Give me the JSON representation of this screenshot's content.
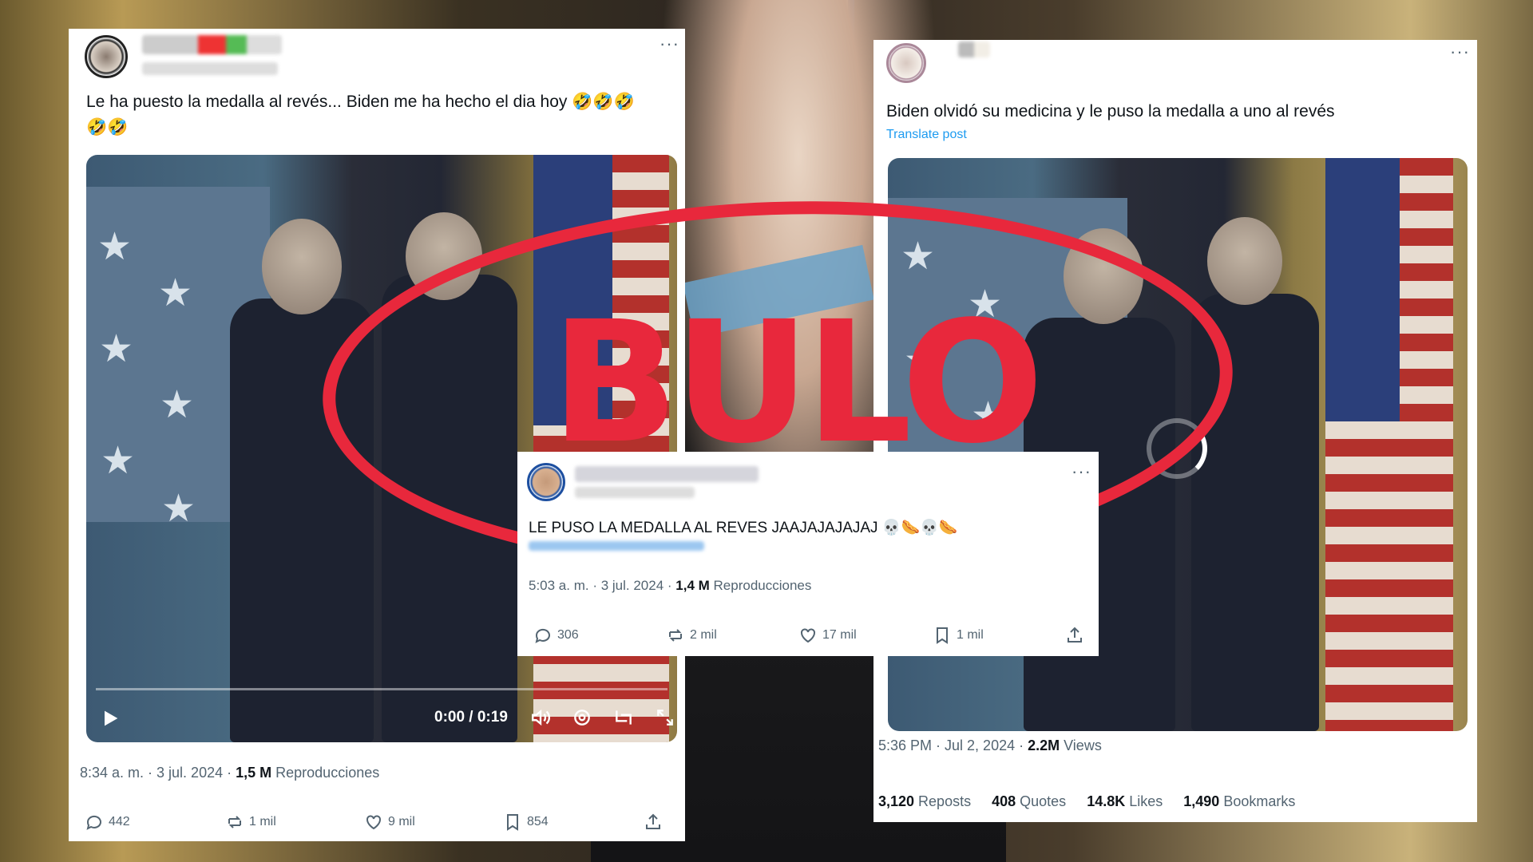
{
  "stamp": {
    "label": "BULO"
  },
  "post_left": {
    "text_line1": "Le ha puesto la medalla al revés... Biden me ha hecho el dia hoy 🤣🤣🤣",
    "text_line2": "🤣🤣",
    "video_time": "0:00 / 0:19",
    "meta": {
      "time": "8:34 a. m. · 3 jul. 2024 · ",
      "views_count": "1,5 M",
      "views_label": " Reproducciones"
    },
    "actions": {
      "replies": "442",
      "reposts": "1 mil",
      "likes": "9 mil",
      "bookmarks": "854"
    }
  },
  "post_right": {
    "text": "Biden olvidó su medicina y le puso la medalla a uno al revés",
    "translate": "Translate post",
    "meta": {
      "time": "5:36 PM · Jul 2, 2024 · ",
      "views_count": "2.2M",
      "views_label": " Views"
    },
    "stats": [
      {
        "count": "3,120",
        "label": " Reposts"
      },
      {
        "count": "408",
        "label": " Quotes"
      },
      {
        "count": "14.8K",
        "label": " Likes"
      },
      {
        "count": "1,490",
        "label": " Bookmarks"
      }
    ]
  },
  "post_center": {
    "text": "LE PUSO LA MEDALLA AL REVES JAAJAJAJAJAJ 💀🌭💀🌭",
    "meta": {
      "time": "5:03 a. m. · 3 jul. 2024 · ",
      "views_count": "1,4 M",
      "views_label": " Reproducciones"
    },
    "actions": {
      "replies": "306",
      "reposts": "2 mil",
      "likes": "17 mil",
      "bookmarks": "1 mil"
    }
  },
  "more_icon": "···"
}
